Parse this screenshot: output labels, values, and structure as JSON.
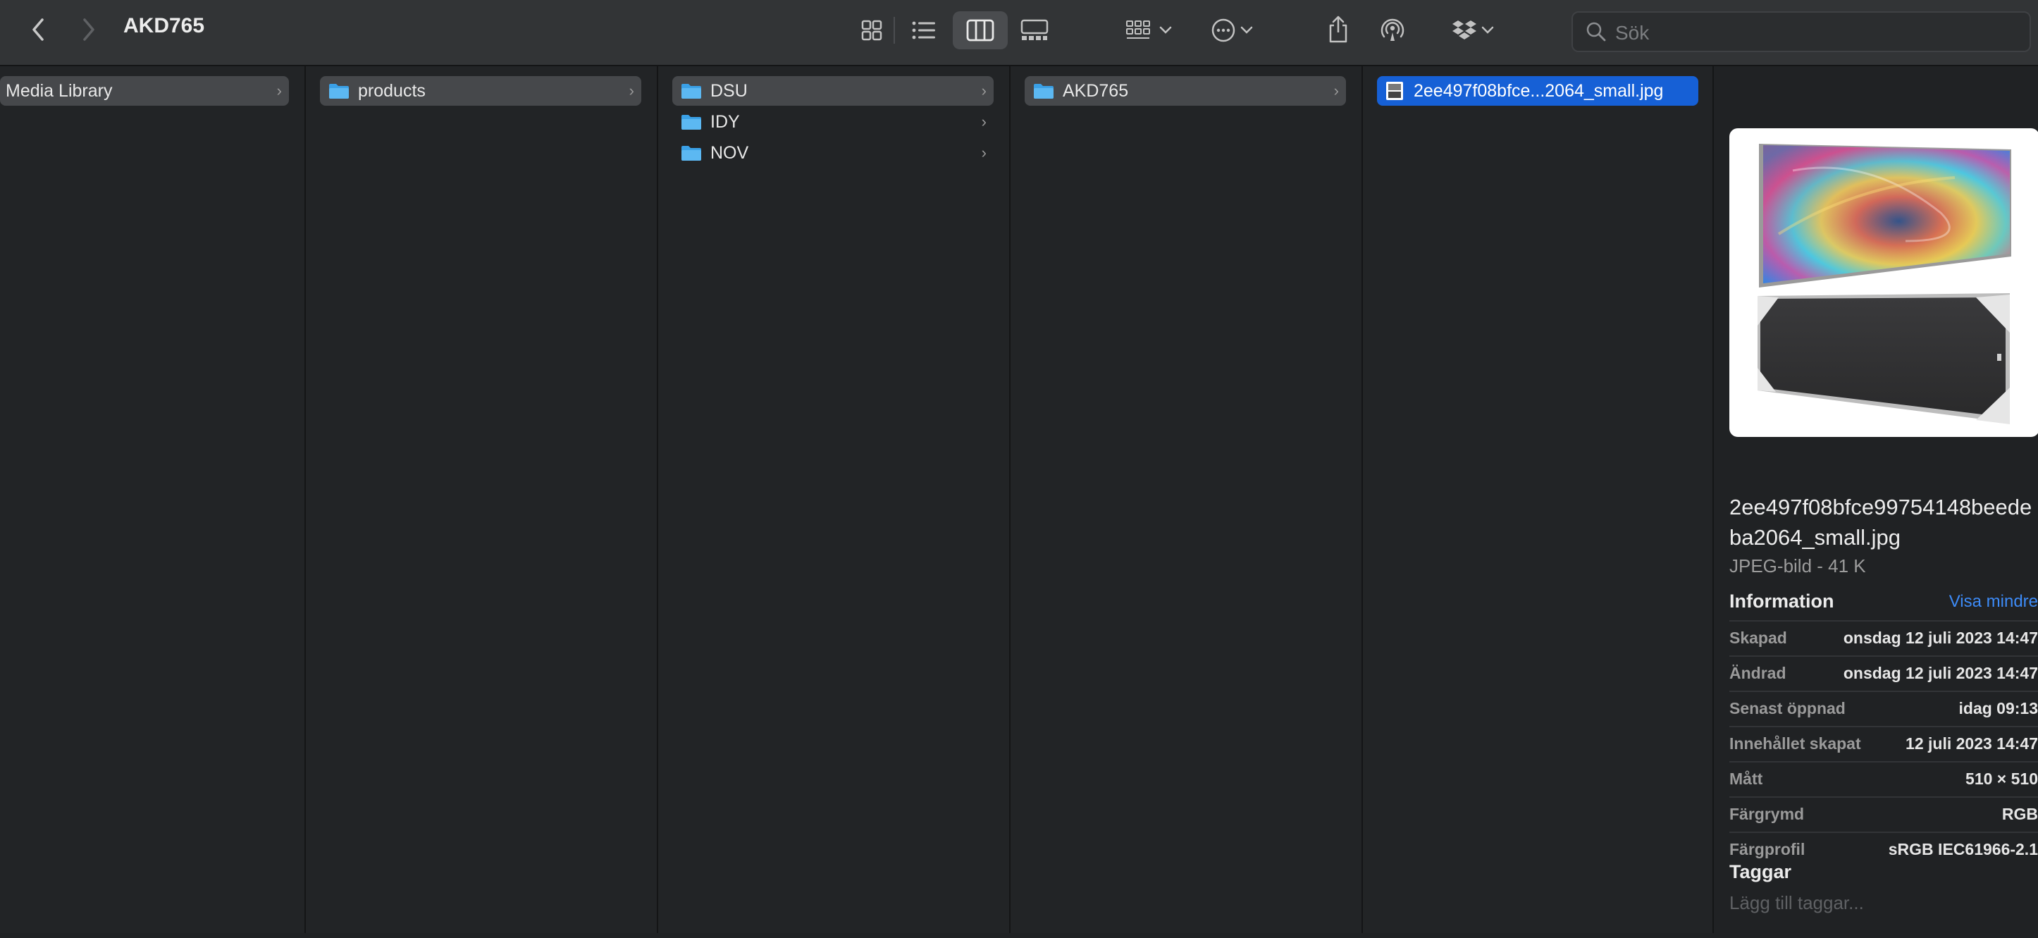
{
  "window": {
    "title": "AKD765"
  },
  "toolbar": {
    "back_icon": "chevron-left-icon",
    "forward_icon": "chevron-right-icon",
    "view_modes": [
      "icon-view",
      "list-view",
      "column-view",
      "gallery-view"
    ],
    "active_view": "column-view",
    "search_placeholder": "Sök"
  },
  "columns": [
    {
      "items": [
        {
          "label": "Media Library",
          "selected": true
        }
      ]
    },
    {
      "items": [
        {
          "label": "products",
          "selected": true
        }
      ]
    },
    {
      "items": [
        {
          "label": "DSU",
          "selected": true
        },
        {
          "label": "IDY"
        },
        {
          "label": "NOV"
        }
      ]
    },
    {
      "items": [
        {
          "label": "AKD765",
          "selected": true
        }
      ]
    },
    {
      "items": [
        {
          "label": "2ee497f08bfce...2064_small.jpg",
          "active": true
        }
      ]
    }
  ],
  "preview": {
    "filename": "2ee497f08bfce99754148beedeba2064_small.jpg",
    "filetype": "JPEG-bild - 41 K",
    "info_heading": "Information",
    "show_less": "Visa mindre",
    "info": [
      {
        "key": "Skapad",
        "value": "onsdag 12 juli 2023 14:47"
      },
      {
        "key": "Ändrad",
        "value": "onsdag 12 juli 2023 14:47"
      },
      {
        "key": "Senast öppnad",
        "value": "idag 09:13"
      },
      {
        "key": "Innehållet skapat",
        "value": "12 juli 2023 14:47"
      },
      {
        "key": "Mått",
        "value": "510 × 510"
      },
      {
        "key": "Färgrymd",
        "value": "RGB"
      },
      {
        "key": "Färgprofil",
        "value": "sRGB IEC61966-2.1"
      }
    ],
    "tags_heading": "Taggar",
    "tags_placeholder": "Lägg till taggar..."
  },
  "colors": {
    "accent": "#1660d6",
    "link": "#3d8bf7",
    "background": "#202224"
  }
}
